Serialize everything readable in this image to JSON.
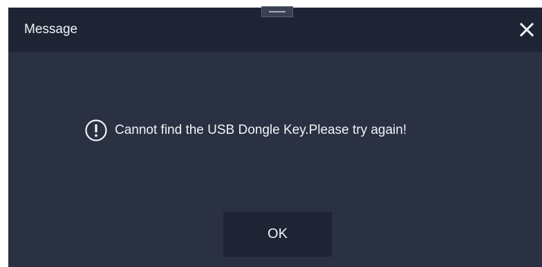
{
  "dialog": {
    "title": "Message",
    "message": "Cannot find the USB Dongle Key.Please try again!",
    "ok_label": "OK",
    "icons": {
      "close": "close-icon",
      "message": "exclamation-circle-icon",
      "drag": "drag-handle-icon"
    }
  },
  "colors": {
    "background": "#2a3142",
    "title_bar": "#1e2434",
    "button": "#1e2434",
    "text": "#f2f4f7"
  }
}
